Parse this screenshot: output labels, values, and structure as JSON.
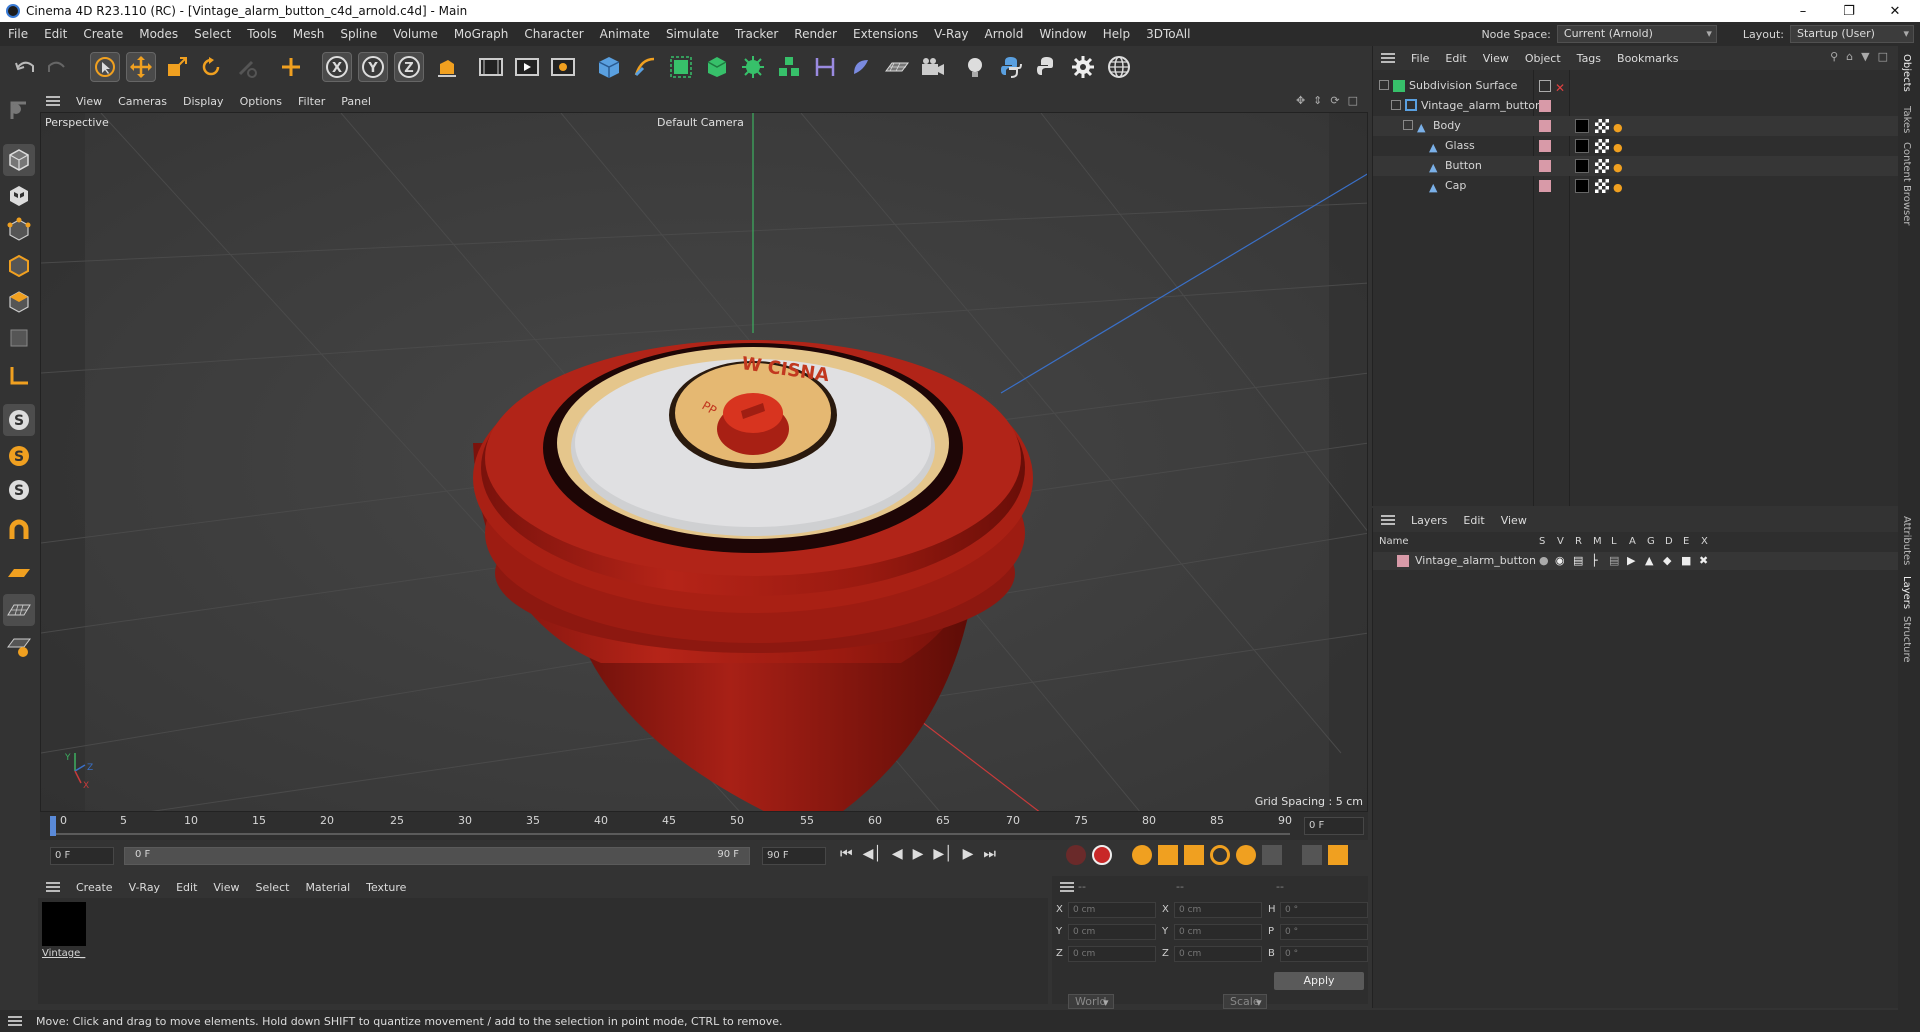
{
  "titlebar": {
    "title": "Cinema 4D R23.110 (RC) - [Vintage_alarm_button_c4d_arnold.c4d] - Main",
    "minimize": "–",
    "maximize": "❐",
    "close": "✕"
  },
  "menubar": {
    "items": [
      "File",
      "Edit",
      "Create",
      "Modes",
      "Select",
      "Tools",
      "Mesh",
      "Spline",
      "Volume",
      "MoGraph",
      "Character",
      "Animate",
      "Simulate",
      "Tracker",
      "Render",
      "Extensions",
      "V-Ray",
      "Arnold",
      "Window",
      "Help",
      "3DToAll"
    ],
    "node_space_label": "Node Space:",
    "node_space_value": "Current (Arnold)",
    "layout_label": "Layout:",
    "layout_value": "Startup (User)"
  },
  "viewport": {
    "menu": [
      "View",
      "Cameras",
      "Display",
      "Options",
      "Filter",
      "Panel"
    ],
    "name": "Perspective",
    "camera": "Default Camera",
    "grid_spacing": "Grid Spacing : 5 cm",
    "axis_y": "Y",
    "axis_z": "Z",
    "axis_x": "X",
    "model_text": "W CISNA",
    "model_text2": "PP"
  },
  "timeline": {
    "ticks": [
      "0",
      "5",
      "10",
      "15",
      "20",
      "25",
      "30",
      "35",
      "40",
      "45",
      "50",
      "55",
      "60",
      "65",
      "70",
      "75",
      "80",
      "85",
      "90"
    ],
    "current_frame_right": "0 F",
    "start_field": "0 F",
    "range_start": "0 F",
    "range_end": "90 F",
    "end_field": "90 F"
  },
  "materials": {
    "menu": [
      "Create",
      "V-Ray",
      "Edit",
      "View",
      "Select",
      "Material",
      "Texture"
    ],
    "items": [
      {
        "name": "Vintage_"
      }
    ]
  },
  "coords": {
    "headers": [
      "--",
      "--",
      "--"
    ],
    "rows": [
      {
        "axis": "X",
        "pos": "0 cm",
        "axis2": "X",
        "size": "0 cm",
        "axis3": "H",
        "rot": "0 °"
      },
      {
        "axis": "Y",
        "pos": "0 cm",
        "axis2": "Y",
        "size": "0 cm",
        "axis3": "P",
        "rot": "0 °"
      },
      {
        "axis": "Z",
        "pos": "0 cm",
        "axis2": "Z",
        "size": "0 cm",
        "axis3": "B",
        "rot": "0 °"
      }
    ],
    "space": "World",
    "mode": "Scale",
    "apply": "Apply"
  },
  "objects": {
    "menu": [
      "File",
      "Edit",
      "View",
      "Object",
      "Tags",
      "Bookmarks"
    ],
    "tree": [
      {
        "name": "Subdivision Surface",
        "level": 0
      },
      {
        "name": "Vintage_alarm_button",
        "level": 1
      },
      {
        "name": "Body",
        "level": 2
      },
      {
        "name": "Glass",
        "level": 3
      },
      {
        "name": "Button",
        "level": 3
      },
      {
        "name": "Cap",
        "level": 3
      }
    ]
  },
  "layers": {
    "menu": [
      "Layers",
      "Edit",
      "View"
    ],
    "col_name": "Name",
    "cols": [
      "S",
      "V",
      "R",
      "M",
      "L",
      "A",
      "G",
      "D",
      "E",
      "X"
    ],
    "items": [
      {
        "name": "Vintage_alarm_button"
      }
    ]
  },
  "vtabs": [
    "Objects",
    "Takes",
    "Content Browser",
    "Attributes",
    "Layers",
    "Structure"
  ],
  "status": "Move: Click and drag to move elements. Hold down SHIFT to quantize movement / add to the selection in point mode, CTRL to remove.",
  "colors": {
    "accent": "#f0a020",
    "model_red": "#a01e14",
    "selection_blue": "#3a7bd5"
  }
}
